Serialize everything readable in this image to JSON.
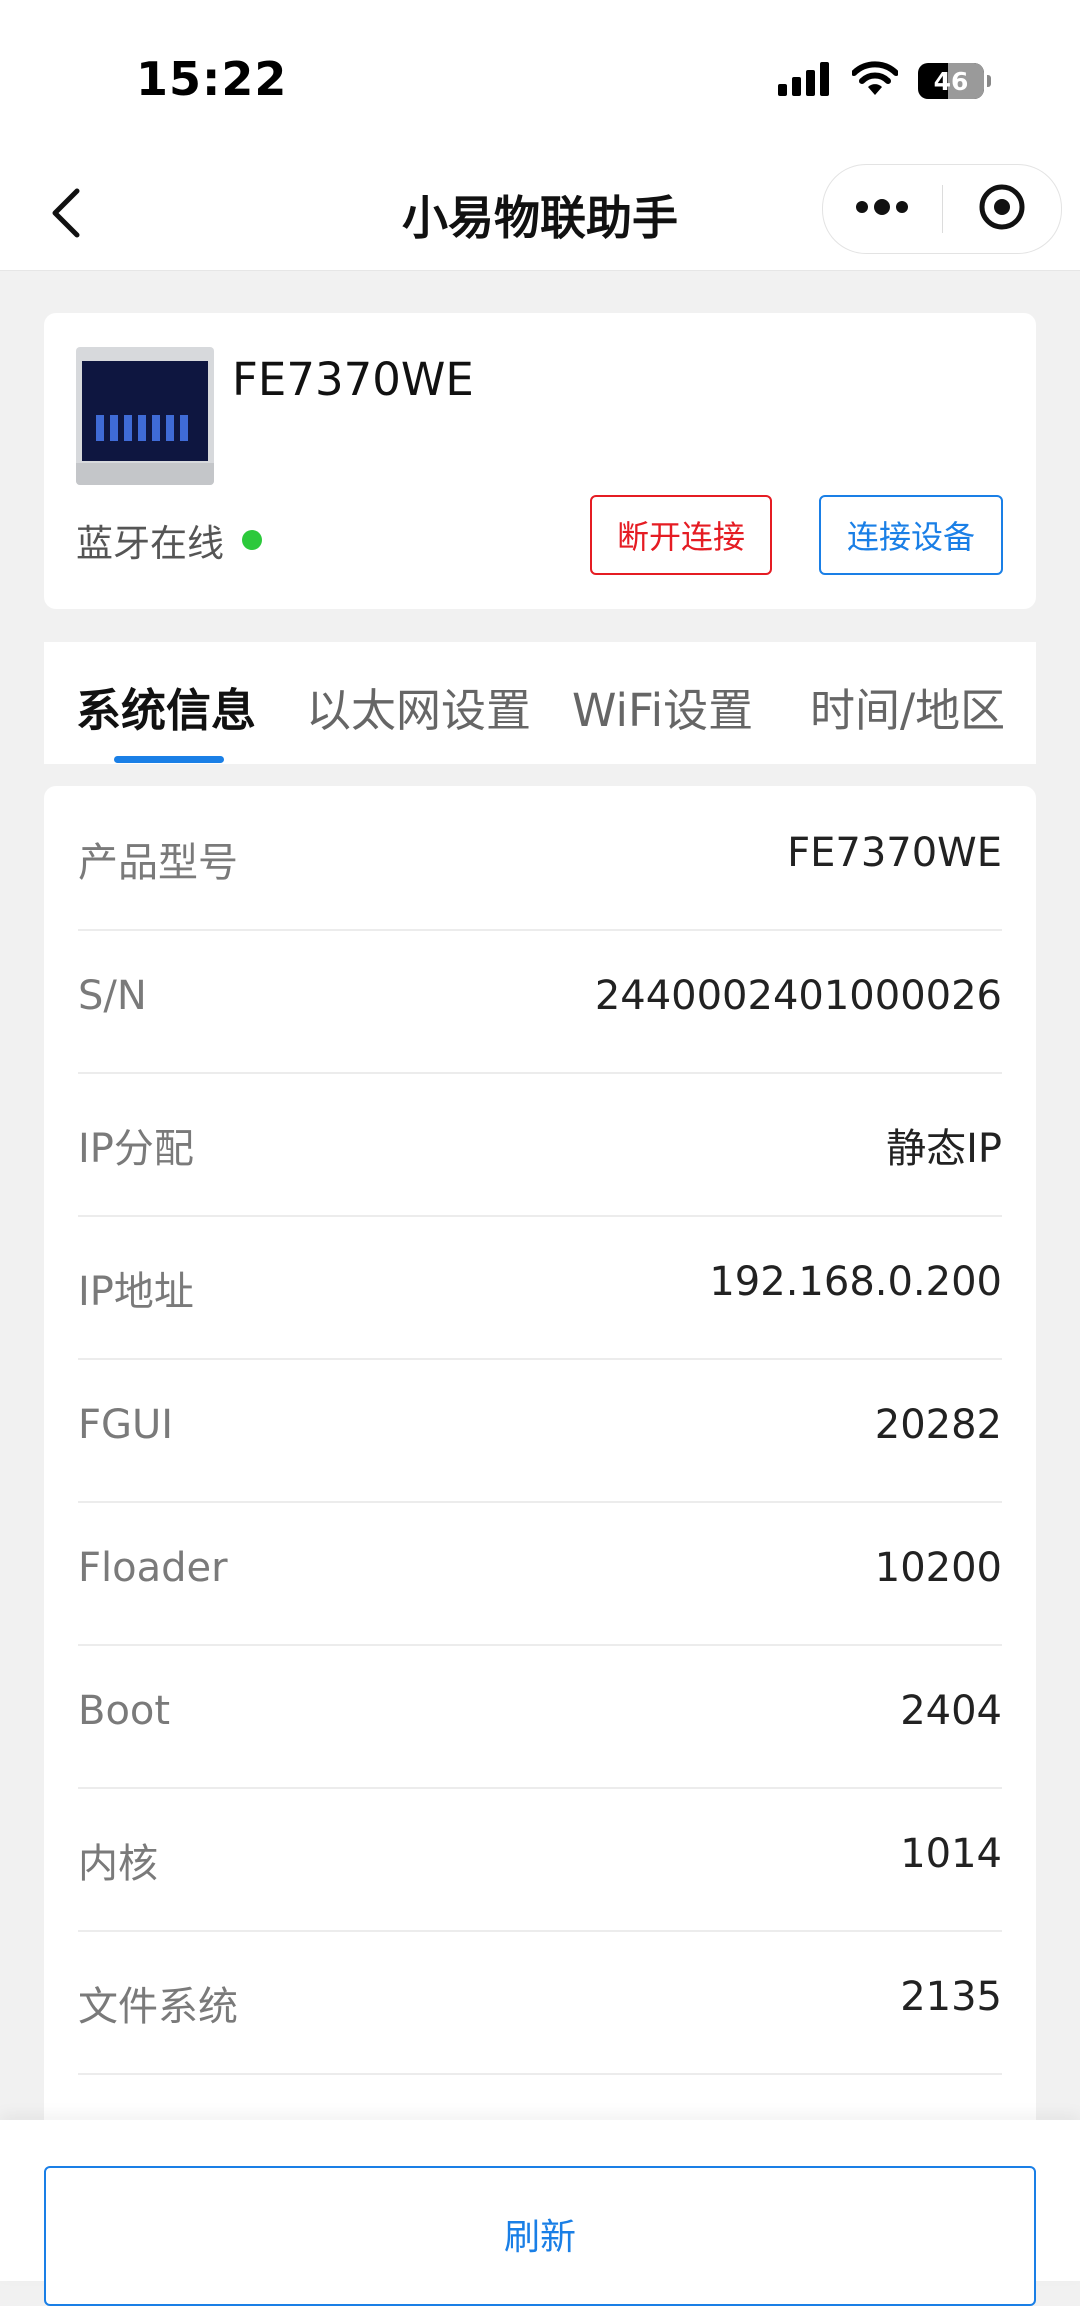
{
  "status_bar": {
    "time": "15:22",
    "battery": "46",
    "battery_level_percent": 46,
    "icons": [
      "signal-icon",
      "wifi-icon",
      "battery-icon"
    ]
  },
  "nav": {
    "title": "小易物联助手",
    "icons": [
      "chevron-left-icon",
      "more-icon",
      "target-icon"
    ]
  },
  "device": {
    "name": "FE7370WE",
    "ble_status": "蓝牙在线",
    "online_color": "#2cc93b",
    "disconnect_label": "断开连接",
    "connect_label": "连接设备"
  },
  "tabs": [
    {
      "label": "系统信息",
      "active": true
    },
    {
      "label": "以太网设置",
      "active": false
    },
    {
      "label": "WiFi设置",
      "active": false
    },
    {
      "label": "时间/地区",
      "active": false
    }
  ],
  "info_rows": [
    {
      "label": "产品型号",
      "value": "FE7370WE"
    },
    {
      "label": "S/N",
      "value": "2440002401000026"
    },
    {
      "label": "IP分配",
      "value": "静态IP"
    },
    {
      "label": "IP地址",
      "value": "192.168.0.200"
    },
    {
      "label": "FGUI",
      "value": "20282"
    },
    {
      "label": "Floader",
      "value": "10200"
    },
    {
      "label": "Boot",
      "value": "2404"
    },
    {
      "label": "内核",
      "value": "1014"
    },
    {
      "label": "文件系统",
      "value": "2135"
    }
  ],
  "footer": {
    "refresh_label": "刷新"
  },
  "colors": {
    "accent": "#1a7fe6",
    "danger": "#e51c23",
    "background": "#f1f1f1"
  }
}
